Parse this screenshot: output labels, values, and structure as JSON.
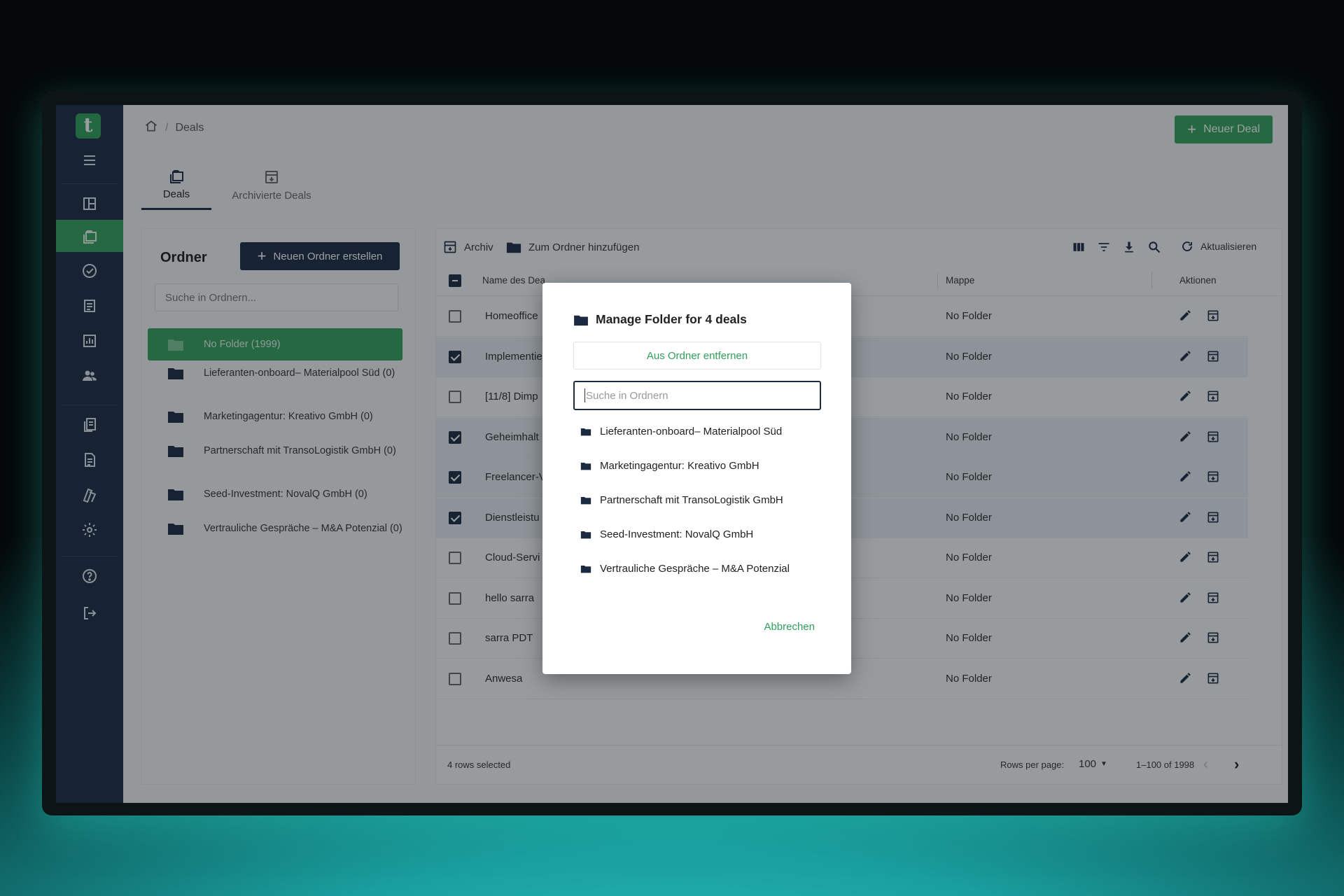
{
  "breadcrumb": {
    "current": "Deals"
  },
  "header": {
    "new_deal_label": "Neuer Deal"
  },
  "tabs": [
    {
      "label": "Deals"
    },
    {
      "label": "Archivierte Deals"
    }
  ],
  "folder_panel": {
    "title": "Ordner",
    "new_folder_label": "Neuen Ordner erstellen",
    "search_placeholder": "Suche in Ordnern...",
    "items": [
      {
        "label": "No Folder (1999)"
      },
      {
        "label": "Lieferanten-onboard– Materialpool Süd (0)"
      },
      {
        "label": "Marketingagentur: Kreativo GmbH (0)"
      },
      {
        "label": "Partnerschaft mit TransoLogistik GmbH (0)"
      },
      {
        "label": "Seed-Investment: NovalQ GmbH (0)"
      },
      {
        "label": "Vertrauliche Gespräche – M&A Potenzial (0)"
      }
    ]
  },
  "toolbar": {
    "archive_label": "Archiv",
    "add_to_folder_label": "Zum Ordner hinzufügen",
    "refresh_label": "Aktualisieren"
  },
  "table": {
    "columns": {
      "name": "Name des Dea",
      "mappe": "Mappe",
      "actions": "Aktionen"
    },
    "rows": [
      {
        "name": "Homeoffice",
        "mappe": "No Folder",
        "selected": false
      },
      {
        "name": "Implementie",
        "mappe": "No Folder",
        "selected": true
      },
      {
        "name": "[11/8] Dimp",
        "mappe": "No Folder",
        "selected": false
      },
      {
        "name": "Geheimhalt",
        "mappe": "No Folder",
        "selected": true
      },
      {
        "name": "Freelancer-V",
        "mappe": "No Folder",
        "selected": true
      },
      {
        "name": "Dienstleistu",
        "mappe": "No Folder",
        "selected": true
      },
      {
        "name": "Cloud-Servi",
        "mappe": "No Folder",
        "selected": false
      },
      {
        "name": "hello sarra",
        "mappe": "No Folder",
        "selected": false
      },
      {
        "name": "sarra PDT",
        "mappe": "No Folder",
        "selected": false
      },
      {
        "name": "Anwesa",
        "mappe": "No Folder",
        "selected": false
      }
    ],
    "footer": {
      "selected_text": "4 rows selected",
      "rows_per_page_label": "Rows per page:",
      "rows_per_page_value": "100",
      "range_text": "1–100 of 1998"
    }
  },
  "modal": {
    "title": "Manage Folder for 4 deals",
    "remove_label": "Aus Ordner entfernen",
    "search_placeholder": "Suche in Ordnern",
    "folders": [
      {
        "label": "Lieferanten-onboard– Materialpool Süd"
      },
      {
        "label": "Marketingagentur: Kreativo GmbH"
      },
      {
        "label": "Partnerschaft mit TransoLogistik GmbH"
      },
      {
        "label": "Seed-Investment: NovalQ GmbH"
      },
      {
        "label": "Vertrauliche Gespräche – M&A Potenzial"
      }
    ],
    "cancel_label": "Abbrechen"
  },
  "colors": {
    "accent": "#34a05c",
    "sidebar": "#1b2a41",
    "dark_button": "#1b2a41"
  }
}
